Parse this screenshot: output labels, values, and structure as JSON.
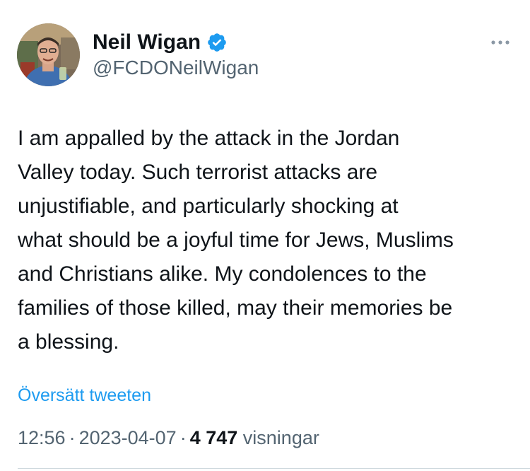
{
  "author": {
    "display_name": "Neil Wigan",
    "handle": "@FCDONeilWigan",
    "verified_icon": "verified-badge-icon",
    "avatar_icon": "avatar-photo"
  },
  "tweet": {
    "text_lines": [
      "I am appalled by the attack in the Jordan",
      "Valley today. Such terrorist attacks are",
      "unjustifiable, and particularly shocking at",
      "what should be a joyful time for Jews, Muslims",
      "and Christians alike. My condolences to the",
      "families of those killed, may their memories be",
      "a blessing."
    ],
    "translate_label": "Översätt tweeten"
  },
  "meta": {
    "time": "12:56",
    "separator": "·",
    "date": "2023-04-07",
    "views_count": "4 747",
    "views_label": "visningar"
  },
  "colors": {
    "text": "#0f1419",
    "secondary": "#536471",
    "link": "#1d9bf0",
    "verified": "#1d9bf0",
    "divider": "#cfd9de"
  },
  "icons": {
    "more": "more-options-icon"
  }
}
